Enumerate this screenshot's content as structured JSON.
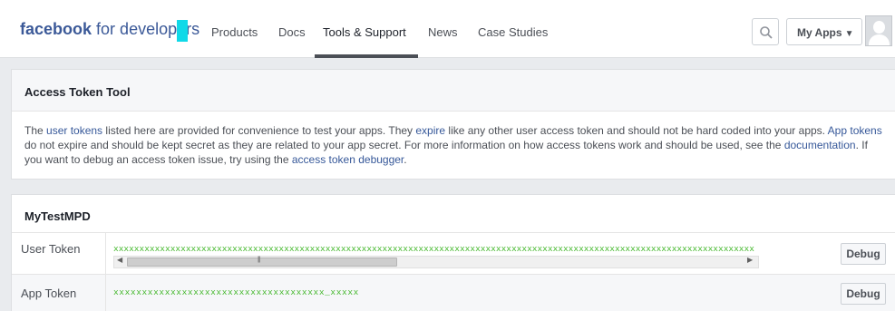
{
  "header": {
    "logo_bold": "facebook",
    "logo_light": "for developers",
    "nav": [
      "Products",
      "Docs",
      "Tools & Support",
      "News",
      "Case Studies"
    ],
    "active_nav": "Tools & Support",
    "my_apps_label": "My Apps",
    "accent_color": "#10d9e8"
  },
  "access_token_tool": {
    "title": "Access Token Tool",
    "description": {
      "p1": "The ",
      "link_user_tokens": "user tokens",
      "p2": " listed here are provided for convenience to test your apps. They ",
      "link_expire": "expire",
      "p3": " like any other user access token and should not be hard coded into your apps. ",
      "link_app_tokens": "App tokens",
      "p4": " do not expire and should be kept secret as they are related to your app secret. For more information on how access tokens work and should be used, see the ",
      "link_documentation": "documentation",
      "p5": ". If you want to debug an access token issue, try using the ",
      "link_debugger": "access token debugger",
      "p6": "."
    }
  },
  "app": {
    "name": "MyTestMPD",
    "rows": [
      {
        "label": "User Token",
        "token": "xxxxxxxxxxxxxxxxxxxxxxxxxxxxxxxxxxxxxxxxxxxxxxxxxxxxxxxxxxxxxxxxxxxxxxxxxxxxxxxxxxxxxxxxxxxxxxxxxxxxxxxxxxxxxxxxxxxxxxxxxxxx",
        "debug_label": "Debug"
      },
      {
        "label": "App Token",
        "token": "xxxxxxxxxxxxxxxxxxxxxxxxxxxxxxxxxxxxx_xxxxx",
        "debug_label": "Debug"
      }
    ]
  }
}
